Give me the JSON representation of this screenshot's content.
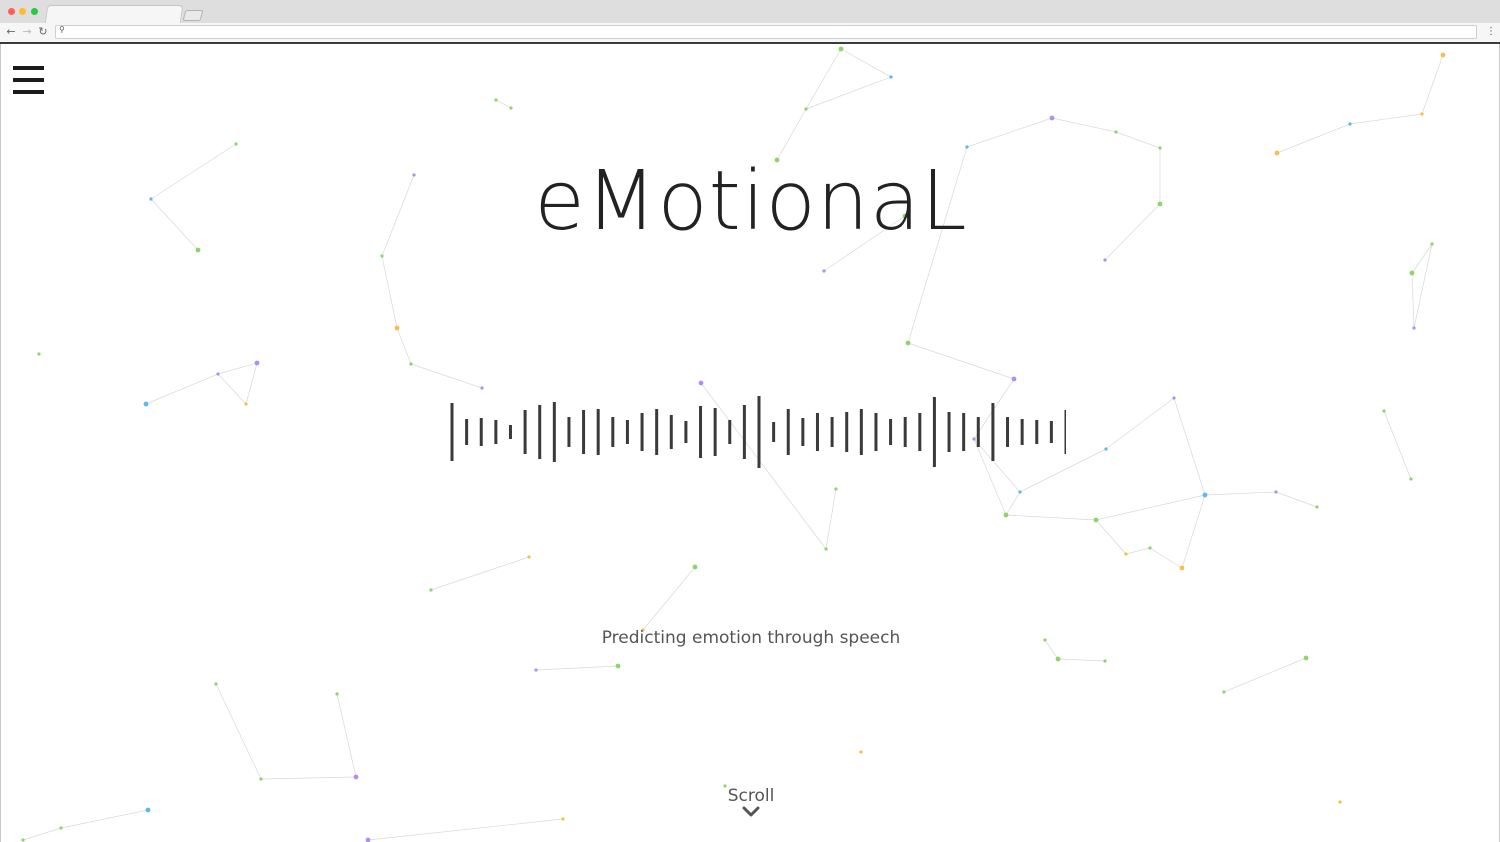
{
  "browser": {
    "traffic_lights": {
      "close": "#ff5f57",
      "minimize": "#febc2e",
      "maximize": "#28c840"
    },
    "nav": {
      "back_icon": "arrow-left-icon",
      "forward_icon": "arrow-right-icon",
      "reload_icon": "reload-icon"
    },
    "address": {
      "value": "",
      "icon": "search-icon"
    },
    "menu_icon": "kebab-icon"
  },
  "page": {
    "menu_icon": "hamburger-icon",
    "title": "eMotionaL",
    "tagline": "Predicting emotion through speech",
    "scroll": {
      "label": "Scroll",
      "icon": "chevron-down-icon"
    },
    "waveform_icon": "sound-wave-icon",
    "network_colors": [
      "#8ed46b",
      "#5bb8f0",
      "#b28ef0",
      "#f5c04a"
    ]
  }
}
